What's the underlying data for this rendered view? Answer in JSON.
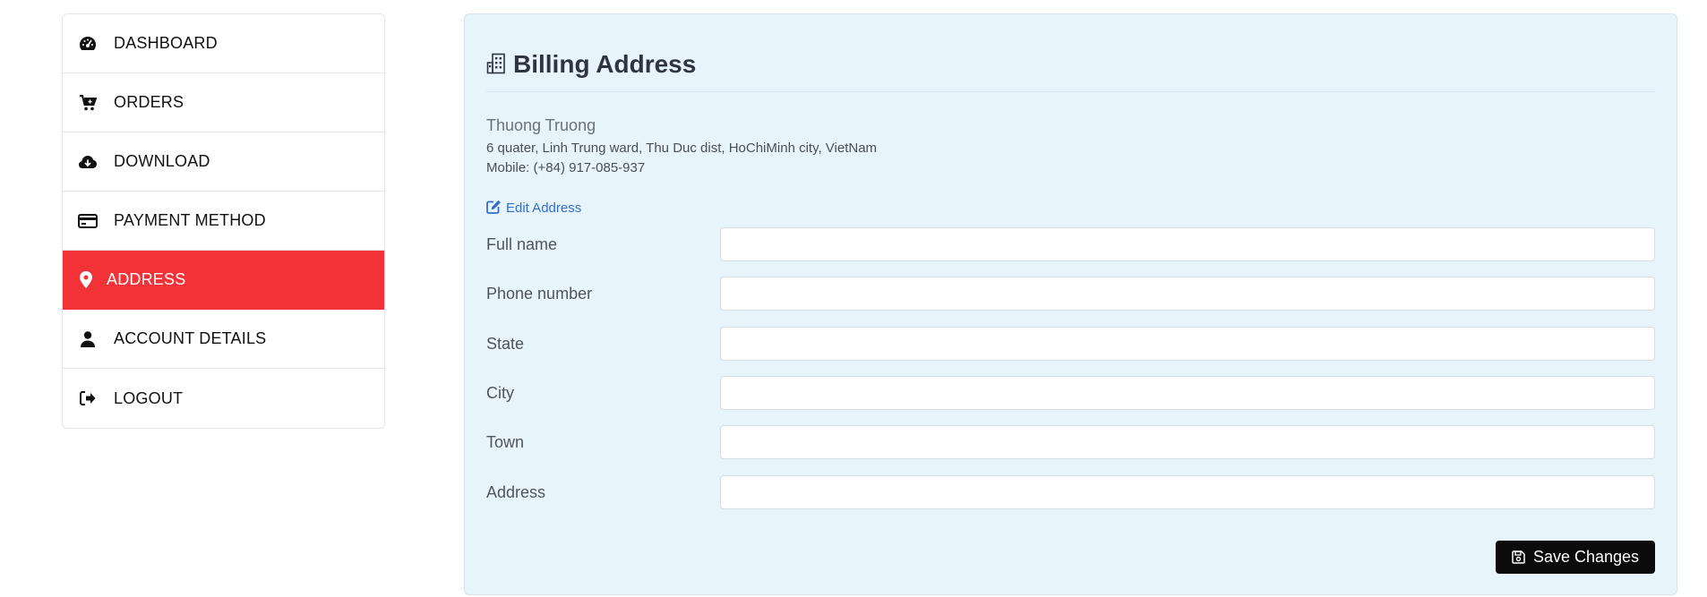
{
  "sidebar": {
    "items": [
      {
        "label": "DASHBOARD",
        "icon": "dashboard-gauge-icon",
        "active": false
      },
      {
        "label": "ORDERS",
        "icon": "cart-icon",
        "active": false
      },
      {
        "label": "DOWNLOAD",
        "icon": "cloud-download-icon",
        "active": false
      },
      {
        "label": "PAYMENT METHOD",
        "icon": "credit-card-icon",
        "active": false
      },
      {
        "label": "ADDRESS",
        "icon": "map-marker-icon",
        "active": true
      },
      {
        "label": "ACCOUNT DETAILS",
        "icon": "user-icon",
        "active": false
      },
      {
        "label": "LOGOUT",
        "icon": "sign-out-icon",
        "active": false
      }
    ]
  },
  "billing": {
    "title": "Billing Address",
    "title_icon": "building-icon",
    "name": "Thuong Truong",
    "address_line": "6 quater, Linh Trung ward, Thu Duc dist, HoChiMinh city, VietNam",
    "mobile_line": "Mobile: (+84) 917-085-937",
    "edit_label": "Edit Address",
    "edit_icon": "edit-icon"
  },
  "form": {
    "fields": [
      {
        "label": "Full name",
        "value": ""
      },
      {
        "label": "Phone number",
        "value": ""
      },
      {
        "label": "State",
        "value": ""
      },
      {
        "label": "City",
        "value": ""
      },
      {
        "label": "Town",
        "value": ""
      },
      {
        "label": "Address",
        "value": ""
      }
    ],
    "save_label": "Save Changes",
    "save_icon": "save-icon"
  },
  "colors": {
    "accent": "#f33237",
    "panel_bg": "#e8f4fc",
    "link": "#2f6fd1",
    "button_bg": "#0b0b0b"
  }
}
